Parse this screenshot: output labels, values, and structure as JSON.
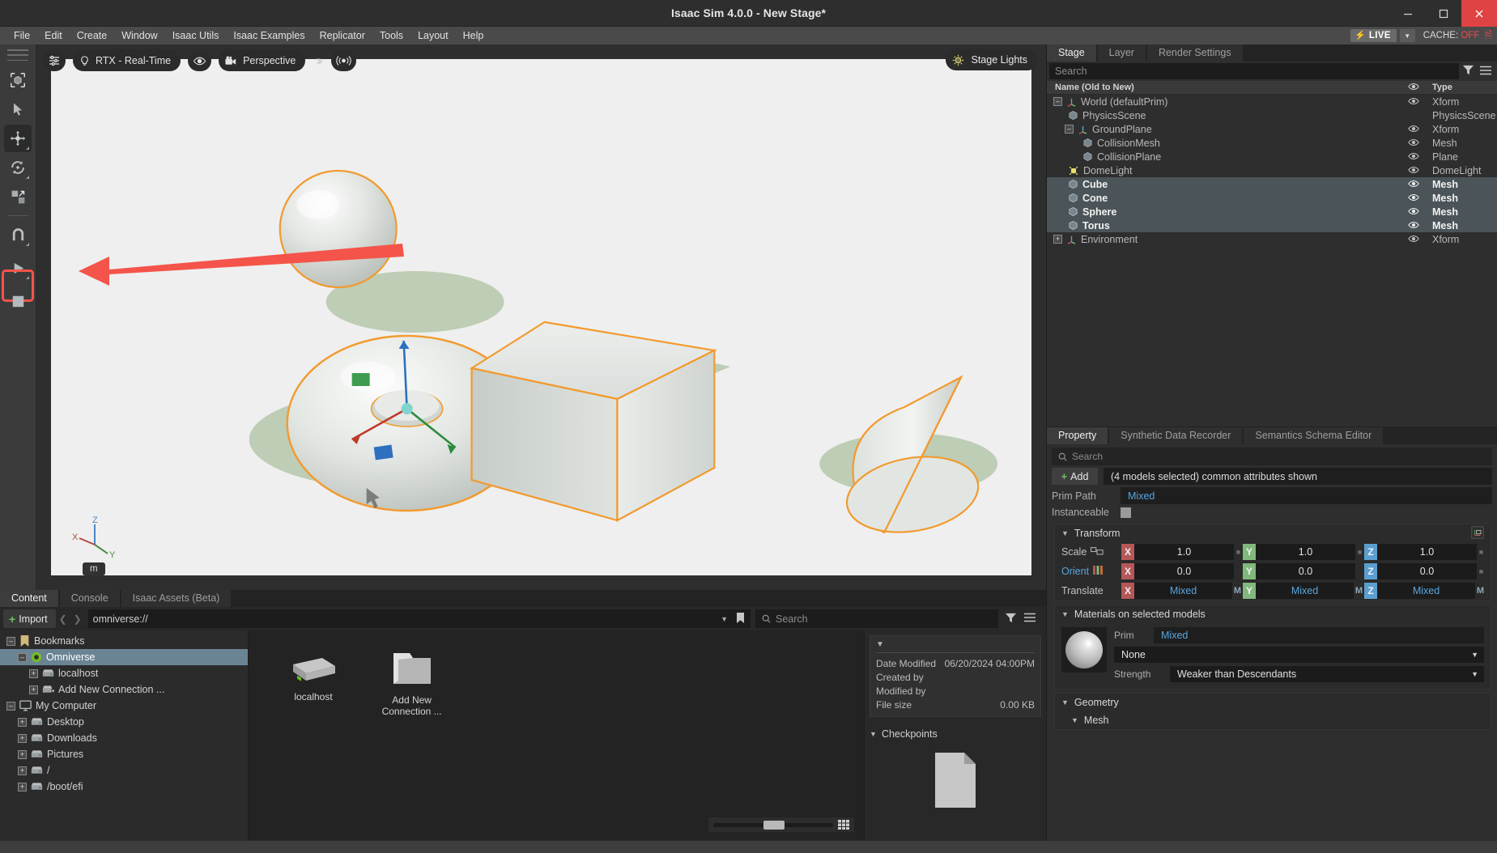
{
  "window": {
    "title": "Isaac Sim 4.0.0 - New Stage*",
    "minimize": "–",
    "maximize": "❐",
    "close": "✕"
  },
  "menubar": {
    "items": [
      "File",
      "Edit",
      "Create",
      "Window",
      "Isaac Utils",
      "Isaac Examples",
      "Replicator",
      "Tools",
      "Layout",
      "Help"
    ],
    "live_label": "LIVE",
    "cache_label": "CACHE:",
    "cache_value": "OFF"
  },
  "left_toolbar": {
    "items": [
      {
        "name": "select-mode-icon",
        "label": "Select"
      },
      {
        "name": "cursor-icon",
        "label": "Cursor"
      },
      {
        "name": "move-tool-icon",
        "label": "Move"
      },
      {
        "name": "rotate-tool-icon",
        "label": "Rotate"
      },
      {
        "name": "scale-tool-icon",
        "label": "Scale"
      },
      {
        "name": "snap-magnet-icon",
        "label": "Snap"
      },
      {
        "name": "play-icon",
        "label": "Play"
      },
      {
        "name": "stop-icon",
        "label": "Stop"
      }
    ],
    "highlighted": "play-icon"
  },
  "viewport": {
    "renderer_label": "RTX - Real-Time",
    "camera_label": "Perspective",
    "stage_lights_label": "Stage Lights",
    "unit_label": "m",
    "axis_labels": {
      "x": "X",
      "y": "Y",
      "z": "Z"
    },
    "settings_icon": "viewport-settings-icon",
    "eye_icon": "visibility-icon",
    "audio_icon": "audio-icon",
    "chevron_icon": "double-chevron-icon"
  },
  "stage_panel": {
    "tabs": [
      {
        "label": "Stage",
        "selected": true
      },
      {
        "label": "Layer",
        "selected": false
      },
      {
        "label": "Render Settings",
        "selected": false
      }
    ],
    "search_placeholder": "Search",
    "filter_icon": "filter-icon",
    "menu_icon": "hamburger-icon",
    "columns": {
      "name": "Name (Old to New)",
      "visibility": "eye-icon",
      "type": "Type"
    },
    "rows": [
      {
        "label": "World (defaultPrim)",
        "type": "Xform",
        "depth": 0,
        "expander": "-",
        "icon": "xform-axis-icon",
        "eye": true,
        "selected": false
      },
      {
        "label": "PhysicsScene",
        "type": "PhysicsScene",
        "depth": 1,
        "expander": "",
        "icon": "mesh-cube-icon",
        "eye": false,
        "selected": false
      },
      {
        "label": "GroundPlane",
        "type": "Xform",
        "depth": 1,
        "expander": "-",
        "icon": "xform-axis-icon",
        "eye": true,
        "selected": false
      },
      {
        "label": "CollisionMesh",
        "type": "Mesh",
        "depth": 2,
        "expander": "",
        "icon": "mesh-cube-icon",
        "eye": true,
        "selected": false
      },
      {
        "label": "CollisionPlane",
        "type": "Plane",
        "depth": 2,
        "expander": "",
        "icon": "mesh-cube-icon",
        "eye": true,
        "selected": false
      },
      {
        "label": "DomeLight",
        "type": "DomeLight",
        "depth": 1,
        "expander": "",
        "icon": "dome-light-icon",
        "eye": true,
        "selected": false
      },
      {
        "label": "Cube",
        "type": "Mesh",
        "depth": 1,
        "expander": "",
        "icon": "mesh-cube-icon",
        "eye": true,
        "selected": true
      },
      {
        "label": "Cone",
        "type": "Mesh",
        "depth": 1,
        "expander": "",
        "icon": "mesh-cube-icon",
        "eye": true,
        "selected": true
      },
      {
        "label": "Sphere",
        "type": "Mesh",
        "depth": 1,
        "expander": "",
        "icon": "mesh-cube-icon",
        "eye": true,
        "selected": true
      },
      {
        "label": "Torus",
        "type": "Mesh",
        "depth": 1,
        "expander": "",
        "icon": "mesh-cube-icon",
        "eye": true,
        "selected": true
      },
      {
        "label": "Environment",
        "type": "Xform",
        "depth": 0,
        "expander": "+",
        "icon": "xform-axis-icon",
        "eye": true,
        "selected": false
      }
    ]
  },
  "property_panel": {
    "tabs": [
      {
        "label": "Property",
        "selected": true
      },
      {
        "label": "Synthetic Data Recorder",
        "selected": false
      },
      {
        "label": "Semantics Schema Editor",
        "selected": false
      }
    ],
    "search_placeholder": "Search",
    "add_label": "Add",
    "selection_summary": "(4 models selected) common attributes shown",
    "prim_path_label": "Prim Path",
    "prim_path_value": "Mixed",
    "instanceable_label": "Instanceable",
    "transform": {
      "title": "Transform",
      "rows": [
        {
          "label": "Scale",
          "icon": "lock-ratio-icon",
          "x": "1.0",
          "y": "1.0",
          "z": "1.0",
          "mixed": false,
          "suffix": ""
        },
        {
          "label": "Orient",
          "icon": "orient-bars-icon",
          "x": "0.0",
          "y": "0.0",
          "z": "0.0",
          "mixed": false,
          "suffix": ""
        },
        {
          "label": "Translate",
          "icon": "",
          "x": "Mixed",
          "y": "Mixed",
          "z": "Mixed",
          "mixed": true,
          "suffix": "M"
        }
      ],
      "gizmo_icon": "transform-gizmo-icon"
    },
    "materials": {
      "title": "Materials on selected models",
      "prim_label": "Prim",
      "prim_value": "Mixed",
      "material_value": "None",
      "strength_label": "Strength",
      "strength_value": "Weaker than Descendants"
    },
    "geometry": {
      "title": "Geometry",
      "mesh_title": "Mesh"
    }
  },
  "content_browser": {
    "tabs": [
      {
        "label": "Content",
        "selected": true
      },
      {
        "label": "Console",
        "selected": false
      },
      {
        "label": "Isaac Assets (Beta)",
        "selected": false
      }
    ],
    "import_label": "Import",
    "path_value": "omniverse://",
    "search_placeholder": "Search",
    "tree": [
      {
        "label": "Bookmarks",
        "depth": 0,
        "expander": "-",
        "icon": "bookmark-icon",
        "selected": false
      },
      {
        "label": "Omniverse",
        "depth": 1,
        "expander": "-",
        "icon": "omniverse-icon",
        "selected": true
      },
      {
        "label": "localhost",
        "depth": 2,
        "expander": "+",
        "icon": "drive-icon",
        "selected": false
      },
      {
        "label": "Add New Connection ...",
        "depth": 2,
        "expander": "+",
        "icon": "add-drive-icon",
        "selected": false
      },
      {
        "label": "My Computer",
        "depth": 0,
        "expander": "-",
        "icon": "computer-icon",
        "selected": false
      },
      {
        "label": "Desktop",
        "depth": 1,
        "expander": "+",
        "icon": "drive-icon",
        "selected": false
      },
      {
        "label": "Downloads",
        "depth": 1,
        "expander": "+",
        "icon": "drive-icon",
        "selected": false
      },
      {
        "label": "Pictures",
        "depth": 1,
        "expander": "+",
        "icon": "drive-icon",
        "selected": false
      },
      {
        "label": "/",
        "depth": 1,
        "expander": "+",
        "icon": "drive-icon",
        "selected": false
      },
      {
        "label": "/boot/efi",
        "depth": 1,
        "expander": "+",
        "icon": "drive-icon",
        "selected": false
      }
    ],
    "assets": [
      {
        "label": "localhost",
        "icon": "server-drive-icon"
      },
      {
        "label": "Add New Connection ...",
        "icon": "folder-icon"
      }
    ],
    "detail": {
      "date_modified_label": "Date Modified",
      "date_modified_value": "06/20/2024 04:00PM",
      "created_by_label": "Created by",
      "created_by_value": "",
      "modified_by_label": "Modified by",
      "modified_by_value": "",
      "file_size_label": "File size",
      "file_size_value": "0.00 KB",
      "checkpoints_label": "Checkpoints"
    }
  },
  "colors": {
    "accent_blue": "#57a6e0",
    "axis_x": "#b65757",
    "axis_y": "#80b97b",
    "axis_z": "#5b9fd1",
    "highlight_red": "#f4544a",
    "selection_blue": "#6a8494",
    "green_plus": "#6fc060",
    "cache_off": "#ef4a4a"
  }
}
